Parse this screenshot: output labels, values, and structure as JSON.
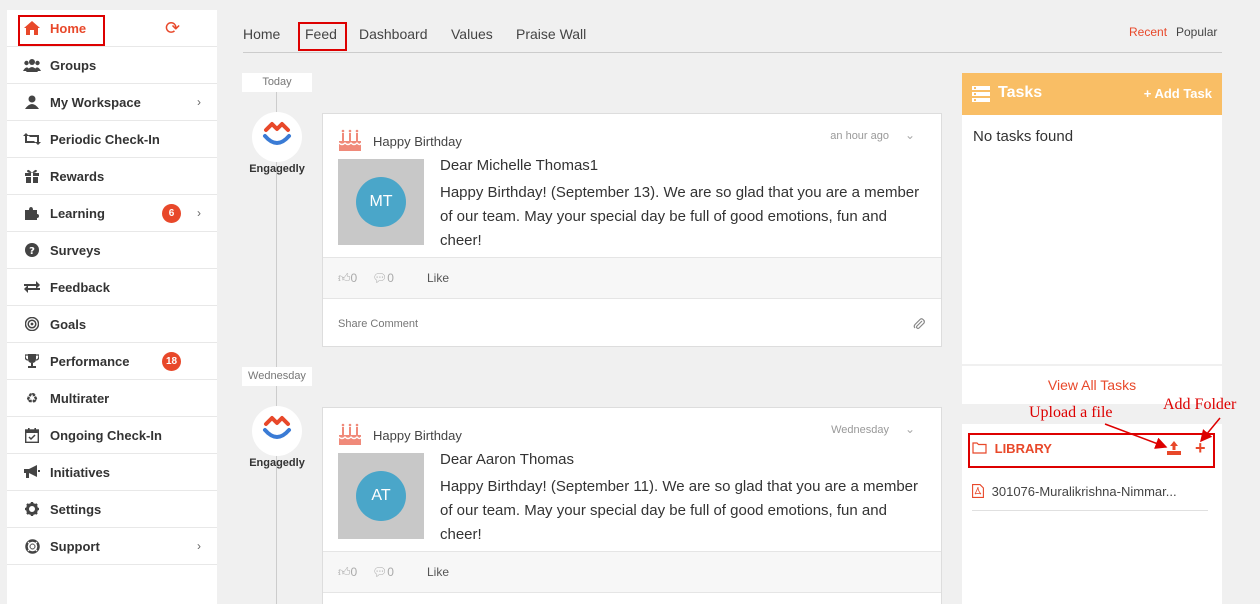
{
  "sidebar": {
    "items": [
      {
        "label": "Home",
        "icon": "home-icon"
      },
      {
        "label": "Groups",
        "icon": "users-icon"
      },
      {
        "label": "My Workspace",
        "icon": "user-icon"
      },
      {
        "label": "Periodic Check-In",
        "icon": "retweet-icon"
      },
      {
        "label": "Rewards",
        "icon": "gift-icon"
      },
      {
        "label": "Learning",
        "icon": "puzzle-icon",
        "badge": "6"
      },
      {
        "label": "Surveys",
        "icon": "question-icon"
      },
      {
        "label": "Feedback",
        "icon": "exchange-icon"
      },
      {
        "label": "Goals",
        "icon": "bullseye-icon"
      },
      {
        "label": "Performance",
        "icon": "trophy-icon",
        "badge": "18"
      },
      {
        "label": "Multirater",
        "icon": "recycle-icon"
      },
      {
        "label": "Ongoing Check-In",
        "icon": "calendar-check-icon"
      },
      {
        "label": "Initiatives",
        "icon": "bullhorn-icon"
      },
      {
        "label": "Settings",
        "icon": "gear-icon"
      },
      {
        "label": "Support",
        "icon": "lifebuoy-icon"
      }
    ]
  },
  "topnav": {
    "tabs": [
      "Home",
      "Feed",
      "Dashboard",
      "Values",
      "Praise Wall"
    ],
    "recent": "Recent",
    "popular": "Popular"
  },
  "feed": {
    "dates": [
      "Today",
      "Wednesday"
    ],
    "posts": [
      {
        "author": "Engagedly",
        "type": "Happy Birthday",
        "time": "an hour ago",
        "initials": "MT",
        "dear": "Dear Michelle Thomas1",
        "message": "Happy Birthday! (September 13). We are so glad that you are a member of our team. May your special day be full of good emotions, fun and cheer!",
        "likes": "0",
        "comments": "0",
        "like_label": "Like",
        "comment_placeholder": "Share Comment"
      },
      {
        "author": "Engagedly",
        "type": "Happy Birthday",
        "time": "Wednesday",
        "initials": "AT",
        "dear": "Dear Aaron Thomas",
        "message": "Happy Birthday! (September 11). We are so glad that you are a member of our team. May your special day be full of good emotions, fun and cheer!",
        "likes": "0",
        "comments": "0",
        "like_label": "Like"
      }
    ]
  },
  "tasks": {
    "title": "Tasks",
    "add": "+ Add Task",
    "empty": "No tasks found",
    "view_all": "View All Tasks"
  },
  "library": {
    "title": "LIBRARY",
    "file": "301076-Muralikrishna-Nimmar..."
  },
  "annotations": {
    "upload": "Upload a file",
    "add_folder": "Add Folder"
  },
  "colors": {
    "accent": "#e8482a",
    "tasks_header": "#f9be65",
    "avatar": "#4aa6c9",
    "annotation": "#dd0000"
  }
}
